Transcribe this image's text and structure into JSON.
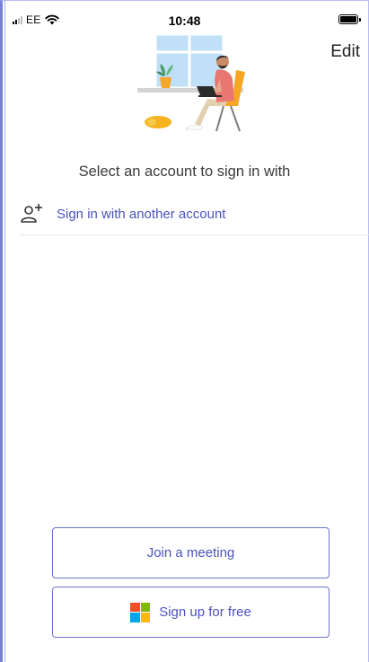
{
  "status_bar": {
    "carrier": "EE",
    "time": "10:48"
  },
  "header": {
    "edit_label": "Edit"
  },
  "prompt": "Select an account to sign in with",
  "account_option": {
    "label": "Sign in with another account",
    "icon": "add-user-icon"
  },
  "actions": {
    "join_label": "Join a meeting",
    "signup_label": "Sign up for free"
  },
  "colors": {
    "accent": "#4b53bc",
    "ms_red": "#f25022",
    "ms_green": "#7fba00",
    "ms_blue": "#00a4ef",
    "ms_yellow": "#ffb900"
  }
}
